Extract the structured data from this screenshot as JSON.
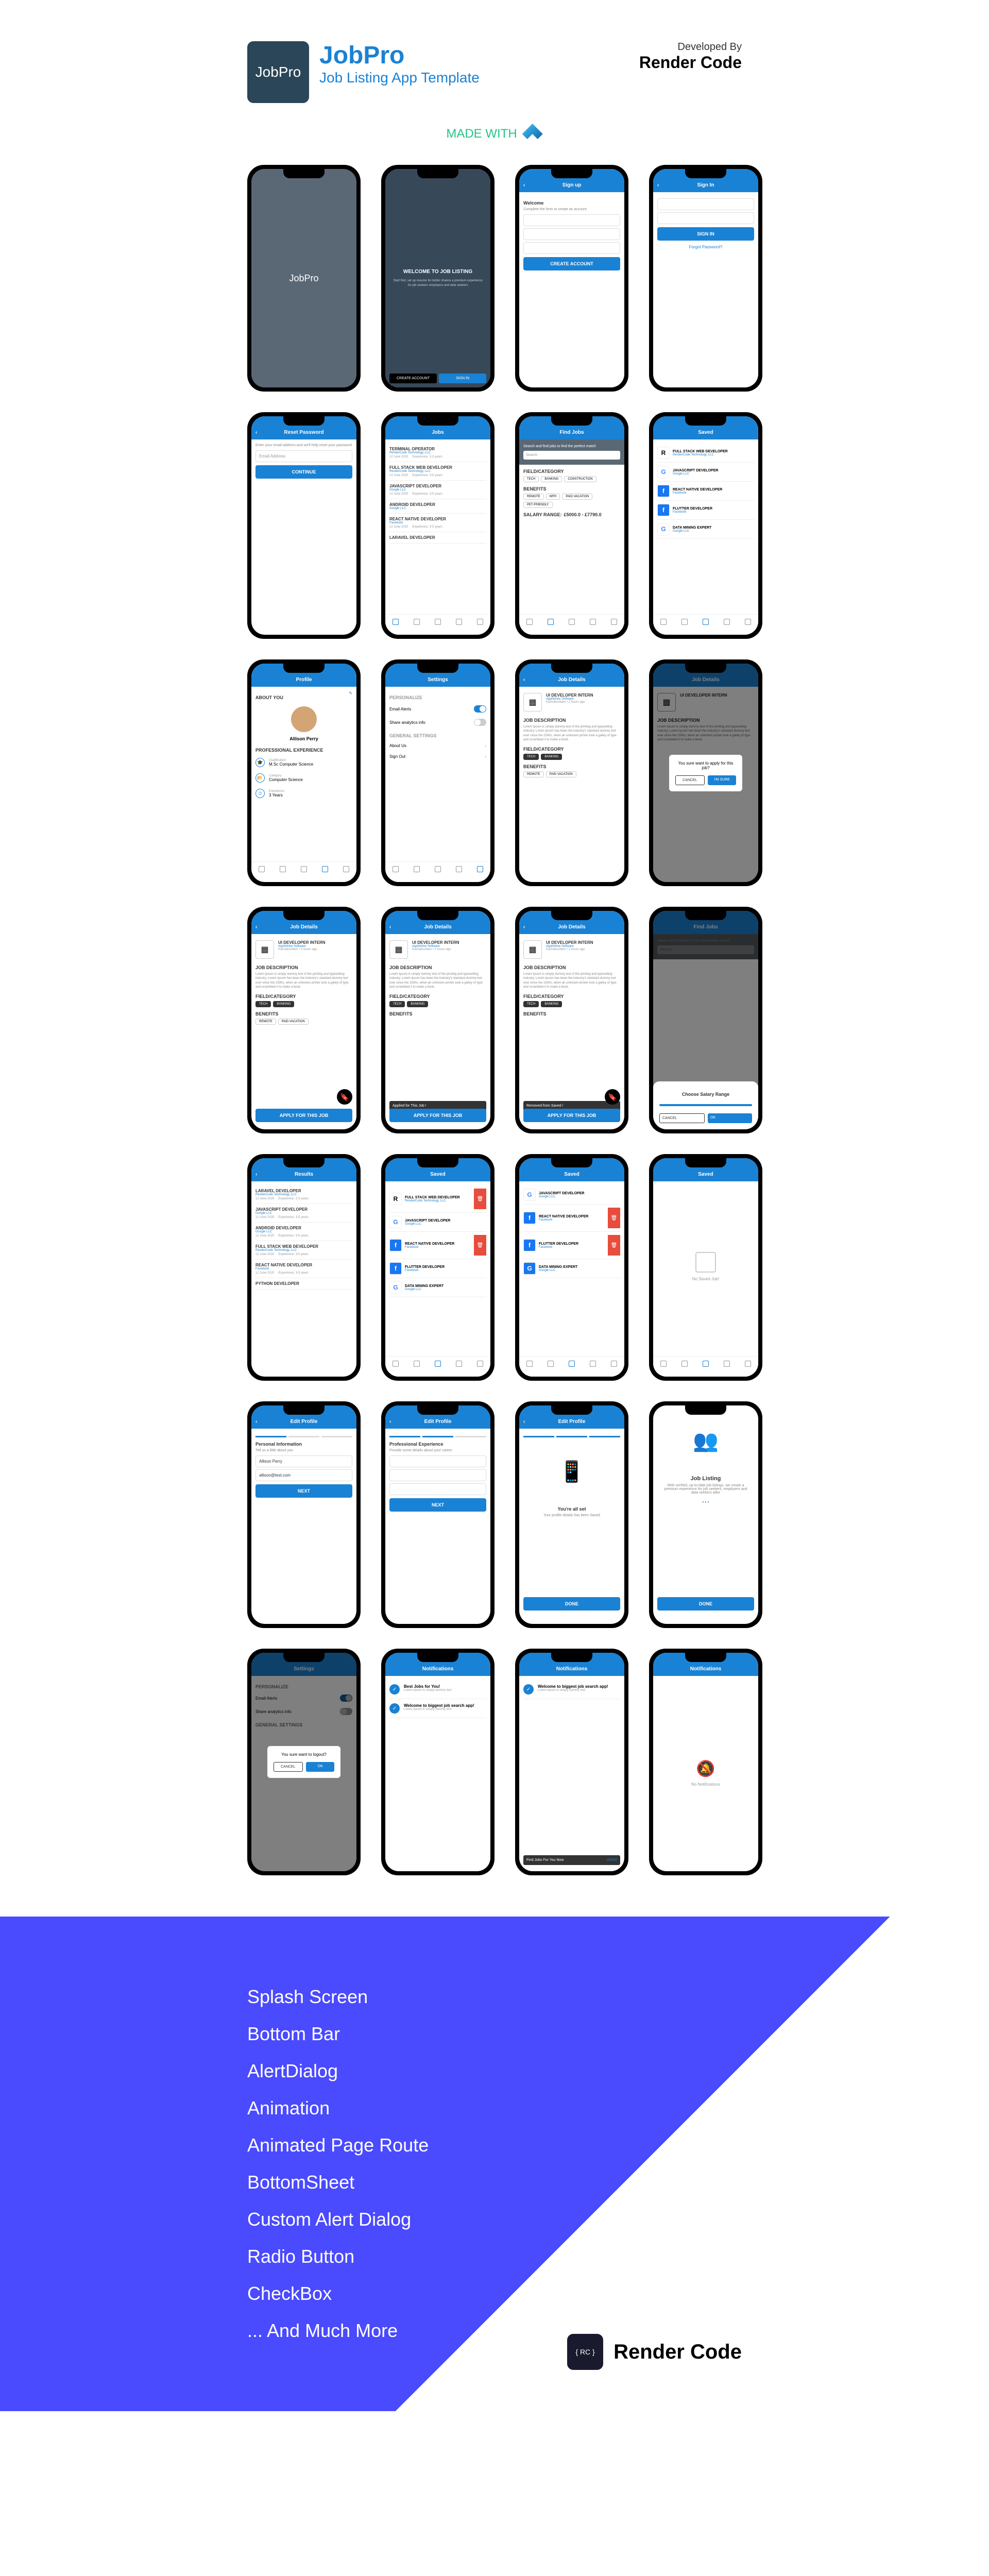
{
  "header": {
    "logo": "JobPro",
    "title": "JobPro",
    "subtitle": "Job Listing App Template",
    "dev_label": "Developed By",
    "dev_name": "Render Code",
    "made_with": "MADE WITH"
  },
  "splash": {
    "title": "JobPro"
  },
  "welcome": {
    "title": "WELCOME TO JOB LISTING",
    "desc": "Start find, set up resume for better chance a premium experience for job seekers employers and data seekers",
    "create": "CREATE ACCOUNT",
    "signin": "SIGN IN"
  },
  "signup": {
    "appbar": "Sign up",
    "heading": "Welcome",
    "sub": "Complete the form to create an account",
    "btn": "CREATE ACCOUNT"
  },
  "signin": {
    "appbar": "Sign In",
    "btn": "SIGN IN",
    "forgot": "Forgot Password?"
  },
  "reset": {
    "appbar": "Reset Password",
    "desc": "Enter your email address and we'll help reset your password",
    "ph": "Email Address",
    "btn": "CONTINUE"
  },
  "jobs": {
    "appbar": "Jobs",
    "items": [
      {
        "t": "TERMINAL OPERATOR",
        "c": "RenderCode Technology, LLC",
        "d": "12 June 2020",
        "e": "Experience: 2-3 years"
      },
      {
        "t": "FULL STACK WEB DEVELOPER",
        "c": "RenderCode Technology, LLC",
        "d": "12 June 2020",
        "e": "Experience: 3-5 years"
      },
      {
        "t": "JAVASCRIPT DEVELOPER",
        "c": "Google LLC",
        "d": "12 June 2020",
        "e": "Experience: 3-5 years"
      },
      {
        "t": "ANDROID DEVELOPER",
        "c": "Google LLC",
        "d": "",
        "e": ""
      },
      {
        "t": "REACT NATIVE DEVELOPER",
        "c": "Facebook",
        "d": "12 June 2020",
        "e": "Experience: 3-5 years"
      },
      {
        "t": "LARAVEL DEVELOPER",
        "c": "",
        "d": "",
        "e": ""
      }
    ]
  },
  "results": {
    "appbar": "Results",
    "items": [
      {
        "t": "LARAVEL DEVELOPER",
        "c": "RenderCode Technology, LLC",
        "d": "12 June 2020",
        "e": "Experience: 2-3 years"
      },
      {
        "t": "JAVASCRIPT DEVELOPER",
        "c": "Google LLC",
        "d": "12 June 2020",
        "e": "Experience: 3-5 years"
      },
      {
        "t": "ANDROID DEVELOPER",
        "c": "Google LLC",
        "d": "12 June 2020",
        "e": "Experience: 3-5 years"
      },
      {
        "t": "FULL STACK WEB DEVELOPER",
        "c": "RenderCode Technology, LLC",
        "d": "12 June 2020",
        "e": "Experience: 3-5 years"
      },
      {
        "t": "REACT NATIVE DEVELOPER",
        "c": "Facebook",
        "d": "12 June 2020",
        "e": "Experience: 3-5 years"
      },
      {
        "t": "PYTHON DEVELOPER",
        "c": "",
        "d": "",
        "e": ""
      }
    ]
  },
  "find": {
    "appbar": "Find Jobs",
    "hero": "Search and find jobs to find the perfect match",
    "ph": "Search",
    "field": "FIELD/CATEGORY",
    "fields": [
      "TECH",
      "BANKING",
      "CONSTRUCTION"
    ],
    "benefits_label": "BENEFITS",
    "benefits": [
      "REMOTE",
      "WFH",
      "PAID VACATION",
      "PET-FRIENDLY"
    ],
    "salary_label": "SALARY RANGE:",
    "salary": "£5000.0 - £7790.0"
  },
  "salary_sheet": {
    "title": "Choose Salary Range",
    "cancel": "CANCEL",
    "ok": "OK"
  },
  "saved": {
    "appbar": "Saved",
    "items": [
      {
        "l": "R",
        "t": "FULL STACK WEB DEVELOPER",
        "c": "RenderCode Technology, LLC"
      },
      {
        "l": "G",
        "t": "JAVASCRIPT DEVELOPER",
        "c": "Google LLC"
      },
      {
        "l": "f",
        "t": "REACT NATIVE DEVELOPER",
        "c": "Facebook"
      },
      {
        "l": "f",
        "t": "FLUTTER DEVELOPER",
        "c": "Facebook"
      },
      {
        "l": "G",
        "t": "DATA MINING EXPERT",
        "c": "Google LLC"
      }
    ],
    "empty": "No Saved Job!"
  },
  "profile": {
    "appbar": "Profile",
    "about": "ABOUT YOU",
    "name": "Allison Perry",
    "exp_label": "PROFESSIONAL EXPERIENCE",
    "rows": [
      {
        "ic": "🎓",
        "l": "Qualification",
        "v": "M.Sc Computer Science"
      },
      {
        "ic": "📂",
        "l": "Category",
        "v": "Computer Science"
      },
      {
        "ic": "⏱",
        "l": "Experience",
        "v": "3 Years"
      }
    ]
  },
  "settings": {
    "appbar": "Settings",
    "p": "PERSONALIZE",
    "g": "GENERAL SETTINGS",
    "rows_p": [
      {
        "l": "Email Alerts",
        "toggle": true
      },
      {
        "l": "Share analytics info",
        "toggle": false
      }
    ],
    "rows_g": [
      {
        "l": "About Us"
      },
      {
        "l": "Sign Out"
      }
    ]
  },
  "logout": {
    "msg": "You sure want to logout?",
    "cancel": "CANCEL",
    "ok": "OK"
  },
  "detail": {
    "appbar": "Job Details",
    "t": "UI DEVELOPER INTERN",
    "c": "vigoNdrive Software",
    "m": "Kazhakoottam • 2 hours ago",
    "desc_label": "JOB DESCRIPTION",
    "desc": "Lorem Ipsum is simply dummy text of the printing and typesetting industry. Lorem Ipsum has been the industry's standard dummy text ever since the 1500s, when an unknown printer took a galley of type and scrambled it to make a book.",
    "field_label": "FIELD/CATEGORY",
    "fields": [
      "TECH",
      "BANKING"
    ],
    "benefits_label": "BENEFITS",
    "benefits": [
      "REMOTE",
      "PAID VACATION"
    ],
    "apply": "APPLY FOR THIS JOB",
    "snack_yes": "Applied for This Job !",
    "snack_no": "Removed from Saved !"
  },
  "apply_dialog": {
    "msg": "You sure want to apply for this job?",
    "cancel": "CANCEL",
    "ok": "I'M SURE"
  },
  "edit": {
    "appbar": "Edit Profile",
    "p1_t": "Personal Information",
    "p1_s": "Tell us a little about you",
    "p1_name": "Allison Perry",
    "p1_email": "allison@test.com",
    "p2_t": "Professional Experience",
    "p2_s": "Provide some details about your career",
    "next": "NEXT",
    "done_t": "You're all set",
    "done_s": "Your profile details has been Saved",
    "done": "DONE"
  },
  "onboard": {
    "title": "Job Listing",
    "desc": "With verified, up-to-date job listings, we create a premium experience for job seekers, employers and data seekers alike",
    "btn": "DONE"
  },
  "notif": {
    "appbar": "Notifications",
    "items": [
      {
        "t": "Best Jobs for You!",
        "d": "Lorem Ipsum is simply dummy text"
      },
      {
        "t": "Welcome to biggest job search app!",
        "d": "Lorem Ipsum is simply dummy text"
      }
    ],
    "empty": "No Notifications",
    "undo": "Find Jobs For You Now",
    "undo_btn": "UNDO"
  },
  "features": [
    "Splash Screen",
    "Bottom Bar",
    "AlertDialog",
    "Animation",
    "Animated Page Route",
    "BottomSheet",
    "Custom Alert Dialog",
    "Radio Button",
    "CheckBox",
    "... And Much More"
  ],
  "footer": {
    "logo": "{ RC }",
    "name": "Render Code"
  }
}
